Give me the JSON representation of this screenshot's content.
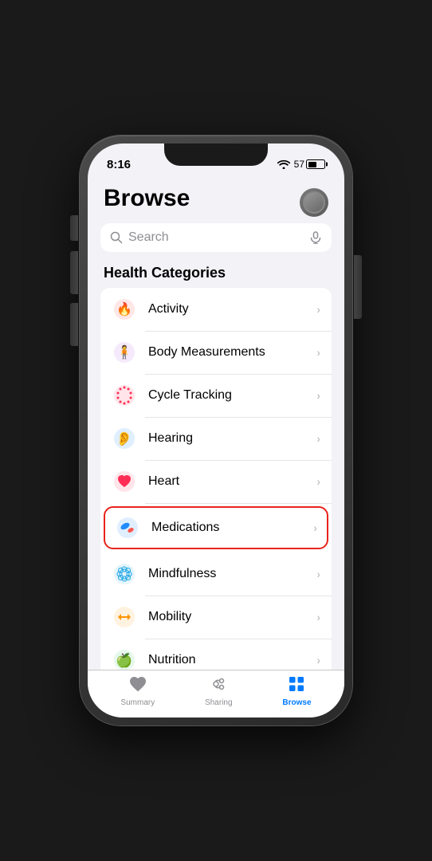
{
  "status": {
    "time": "8:16",
    "battery": "57"
  },
  "header": {
    "title": "Browse",
    "avatar_label": "Profile"
  },
  "search": {
    "placeholder": "Search"
  },
  "section": {
    "title": "Health Categories"
  },
  "categories": [
    {
      "id": "activity",
      "name": "Activity",
      "highlighted": false
    },
    {
      "id": "body-measurements",
      "name": "Body Measurements",
      "highlighted": false
    },
    {
      "id": "cycle-tracking",
      "name": "Cycle Tracking",
      "highlighted": false
    },
    {
      "id": "hearing",
      "name": "Hearing",
      "highlighted": false
    },
    {
      "id": "heart",
      "name": "Heart",
      "highlighted": false
    },
    {
      "id": "medications",
      "name": "Medications",
      "highlighted": true
    },
    {
      "id": "mindfulness",
      "name": "Mindfulness",
      "highlighted": false
    },
    {
      "id": "mobility",
      "name": "Mobility",
      "highlighted": false
    },
    {
      "id": "nutrition",
      "name": "Nutrition",
      "highlighted": false
    }
  ],
  "tabs": [
    {
      "id": "summary",
      "label": "Summary",
      "active": false
    },
    {
      "id": "sharing",
      "label": "Sharing",
      "active": false
    },
    {
      "id": "browse",
      "label": "Browse",
      "active": true
    }
  ]
}
